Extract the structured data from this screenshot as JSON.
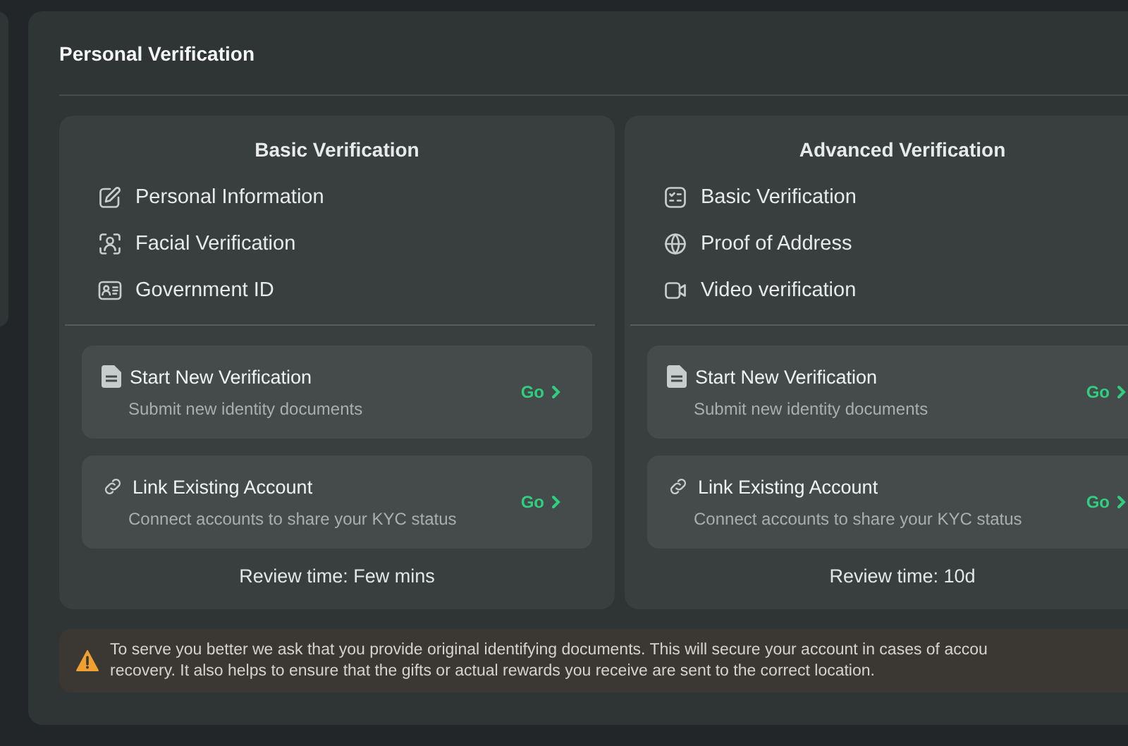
{
  "panel": {
    "title": "Personal Verification"
  },
  "cards": [
    {
      "title": "Basic Verification",
      "features": [
        {
          "kind": "edit",
          "label": "Personal Information"
        },
        {
          "kind": "face",
          "label": "Facial Verification"
        },
        {
          "kind": "idcard",
          "label": "Government ID"
        }
      ],
      "actions": [
        {
          "kind": "document",
          "title": "Start New Verification",
          "description": "Submit new identity documents",
          "go": "Go"
        },
        {
          "kind": "link",
          "title": "Link Existing Account",
          "description": "Connect accounts to share your KYC status",
          "go": "Go"
        }
      ],
      "review": "Review time: Few mins"
    },
    {
      "title": "Advanced Verification",
      "features": [
        {
          "kind": "checklist",
          "label": "Basic Verification"
        },
        {
          "kind": "globe",
          "label": "Proof of Address"
        },
        {
          "kind": "video",
          "label": "Video verification"
        }
      ],
      "actions": [
        {
          "kind": "document",
          "title": "Start New Verification",
          "description": "Submit new identity documents",
          "go": "Go"
        },
        {
          "kind": "link",
          "title": "Link Existing Account",
          "description": "Connect accounts to share your KYC status",
          "go": "Go"
        }
      ],
      "review": "Review time: 10d"
    }
  ],
  "notice": {
    "lines": [
      "To serve you better we ask that you provide original identifying documents. This will secure your account in cases of accou",
      "recovery. It also helps to ensure that the gifts or actual rewards you receive are sent to the correct location."
    ]
  }
}
